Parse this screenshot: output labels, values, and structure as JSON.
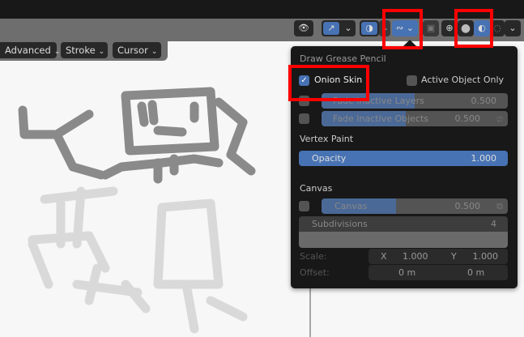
{
  "toolbar": {
    "advanced": "Advanced",
    "stroke": "Stroke",
    "cursor": "Cursor"
  },
  "header_icons": [
    "visibility-icon",
    "gizmo-icon",
    "overlay-icon",
    "grease-pencil-overlay-icon",
    "xray-icon",
    "wireframe-shading-icon",
    "solid-shading-icon",
    "material-preview-icon",
    "rendered-shading-icon"
  ],
  "panel": {
    "title": "Draw Grease Pencil",
    "onion_skin": {
      "label": "Onion Skin",
      "checked": true
    },
    "active_object_only": {
      "label": "Active Object Only",
      "checked": false
    },
    "fade_inactive_layers": {
      "label": "Fade Inactive Layers",
      "value": "0.500",
      "fraction": 0.5
    },
    "fade_inactive_objects": {
      "label": "Fade Inactive Objects",
      "value": "0.500",
      "fraction": 0.5
    },
    "vertex_paint": {
      "heading": "Vertex Paint",
      "opacity_label": "Opacity",
      "opacity_value": "1.000"
    },
    "canvas": {
      "heading": "Canvas",
      "canvas_label": "Canvas",
      "canvas_value": "0.500",
      "subdivisions_label": "Subdivisions",
      "subdivisions_value": "4",
      "scale_label": "Scale:",
      "scale_x_label": "X",
      "scale_x": "1.000",
      "scale_y_label": "Y",
      "scale_y": "1.000",
      "offset_label": "Offset:",
      "offset_x": "0 m",
      "offset_y": "0 m"
    }
  },
  "colors": {
    "accent": "#4772b3",
    "highlight": "#ff0000"
  }
}
